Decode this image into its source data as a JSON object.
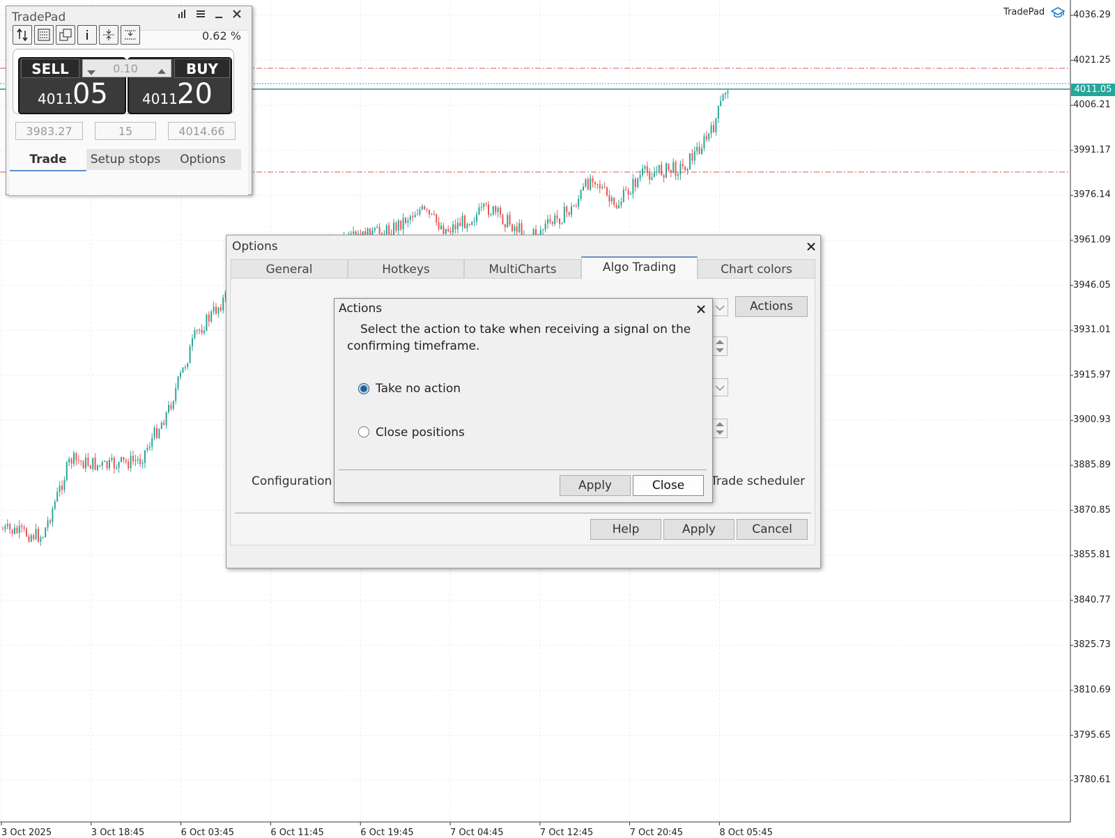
{
  "chart": {
    "brand": "TradePad",
    "current_price": "4011.05",
    "price_labels": [
      "4036.29",
      "4021.25",
      "4006.21",
      "3991.17",
      "3976.14",
      "3961.09",
      "3946.05",
      "3931.01",
      "3915.97",
      "3900.93",
      "3885.89",
      "3870.85",
      "3855.81",
      "3840.77",
      "3825.73",
      "3810.69",
      "3795.65",
      "3780.61"
    ],
    "time_labels": [
      "3 Oct 2025",
      "3 Oct 18:45",
      "6 Oct 03:45",
      "6 Oct 11:45",
      "6 Oct 19:45",
      "7 Oct 04:45",
      "7 Oct 12:45",
      "7 Oct 20:45",
      "8 Oct 05:45"
    ],
    "colors": {
      "bull": "#26a69a",
      "bear": "#ef5350",
      "level": "#e05252"
    }
  },
  "tradepad": {
    "title": "TradePad",
    "percent": "0.62 %",
    "sell_label": "SELL",
    "buy_label": "BUY",
    "volume": "0.10",
    "sell_price_small": "4011.",
    "sell_price_big": "05",
    "buy_price_small": "4011.",
    "buy_price_big": "20",
    "field_left": "3983.27",
    "field_mid": "15",
    "field_right": "4014.66",
    "tabs": [
      "Trade",
      "Setup stops",
      "Options"
    ]
  },
  "options": {
    "title": "Options",
    "tabs": [
      "General",
      "Hotkeys",
      "MultiCharts",
      "Algo Trading",
      "Chart colors"
    ],
    "actions_button": "Actions",
    "configuration": "Configuration",
    "trade_scheduler": "Trade scheduler",
    "help": "Help",
    "apply": "Apply",
    "cancel": "Cancel"
  },
  "actions_dialog": {
    "title": "Actions",
    "description": "Select the action to take when receiving a signal on the confirming timeframe.",
    "option_1": "Take no action",
    "option_2": "Close positions",
    "apply": "Apply",
    "close": "Close"
  }
}
